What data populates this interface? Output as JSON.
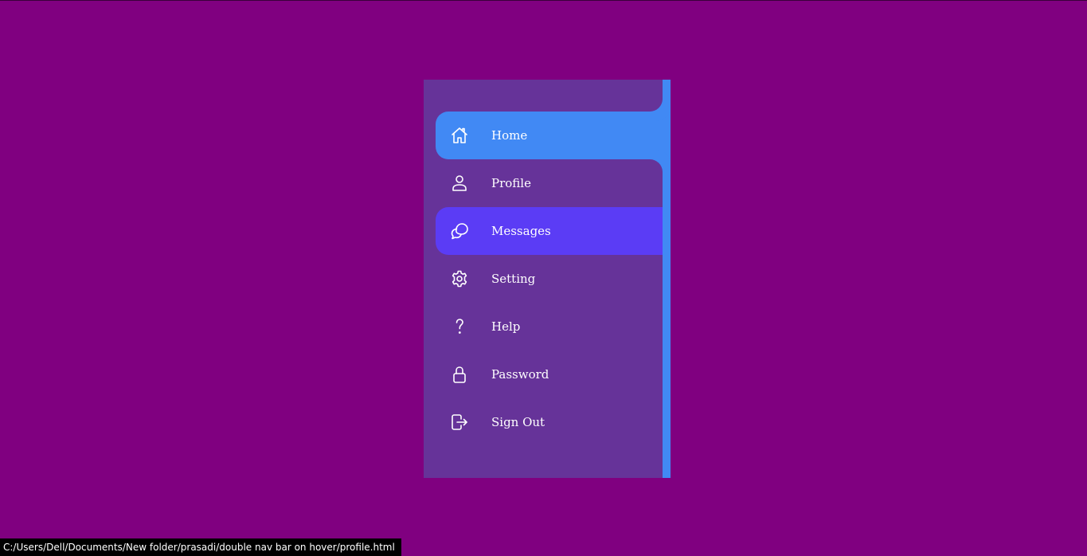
{
  "nav": {
    "items": [
      {
        "label": "Home",
        "icon": "home-icon",
        "state": "active"
      },
      {
        "label": "Profile",
        "icon": "user-icon",
        "state": "default"
      },
      {
        "label": "Messages",
        "icon": "chat-icon",
        "state": "hover"
      },
      {
        "label": "Setting",
        "icon": "gear-icon",
        "state": "default"
      },
      {
        "label": "Help",
        "icon": "question-icon",
        "state": "default"
      },
      {
        "label": "Password",
        "icon": "lock-icon",
        "state": "default"
      },
      {
        "label": "Sign Out",
        "icon": "sign-out-icon",
        "state": "default"
      }
    ]
  },
  "status_bar": {
    "url": "C:/Users/Dell/Documents/New folder/prasadi/double nav bar on hover/profile.html"
  },
  "colors": {
    "page_background": "#800080",
    "panel_background": "#663399",
    "active_item": "#4189f4",
    "hover_item": "#5b3cf5",
    "text": "#ffffff"
  }
}
